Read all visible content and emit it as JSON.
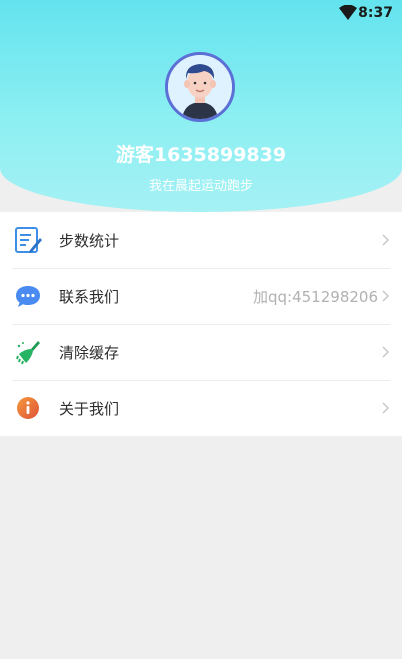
{
  "status": {
    "time": "8:37"
  },
  "profile": {
    "username": "游客1635899839",
    "subtitle": "我在晨起运动跑步"
  },
  "menu": {
    "items": [
      {
        "label": "步数统计",
        "value": "",
        "icon": "notepad-icon"
      },
      {
        "label": "联系我们",
        "value": "加qq:451298206",
        "icon": "chat-bubble-icon"
      },
      {
        "label": "清除缓存",
        "value": "",
        "icon": "broom-icon"
      },
      {
        "label": "关于我们",
        "value": "",
        "icon": "info-icon"
      }
    ]
  },
  "colors": {
    "header_top": "#63e3ee",
    "header_bottom": "#a5f1f4",
    "avatar_border": "#5b6fd6",
    "page_background": "#efefef"
  }
}
